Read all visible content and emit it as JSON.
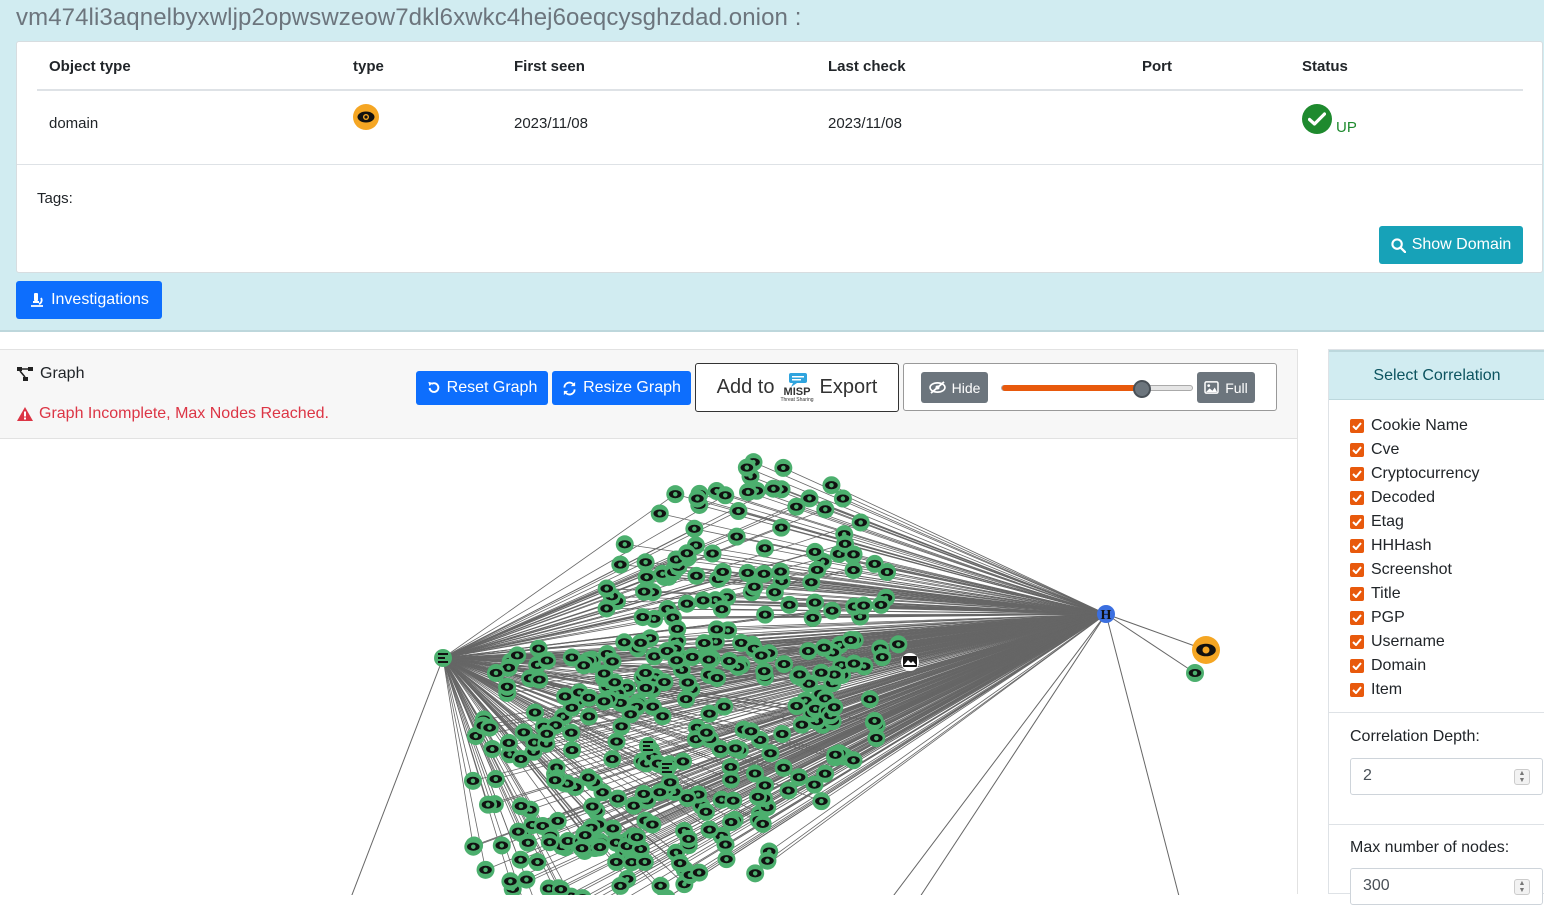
{
  "domain": {
    "title": "vm474li3aqnelbyxwljp2opwswzeow7dkl6xwkc4hej6oeqcysghzdad.onion :",
    "table": {
      "headers": [
        "Object type",
        "type",
        "First seen",
        "Last check",
        "Port",
        "Status"
      ],
      "row": {
        "object_type": "domain",
        "type_icon": "eye-icon",
        "first_seen": "2023/11/08",
        "last_check": "2023/11/08",
        "port": "",
        "status": "UP"
      }
    },
    "tags_label": "Tags:",
    "show_domain_label": "Show Domain"
  },
  "investigations_label": "Investigations",
  "graph": {
    "title": "Graph",
    "warning": "Graph Incomplete, Max Nodes Reached.",
    "reset_label": "Reset Graph",
    "resize_label": "Resize Graph",
    "export_prefix": "Add to",
    "export_logo_text": "MISP",
    "export_logo_sub": "Threat Sharing",
    "export_suffix": "Export",
    "hide_label": "Hide",
    "full_label": "Full",
    "slider_value": 0.73
  },
  "correlation": {
    "header": "Select Correlation",
    "items": [
      {
        "label": "Cookie Name",
        "checked": true
      },
      {
        "label": "Cve",
        "checked": true
      },
      {
        "label": "Cryptocurrency",
        "checked": true
      },
      {
        "label": "Decoded",
        "checked": true
      },
      {
        "label": "Etag",
        "checked": true
      },
      {
        "label": "HHHash",
        "checked": true
      },
      {
        "label": "Screenshot",
        "checked": true
      },
      {
        "label": "Title",
        "checked": true
      },
      {
        "label": "PGP",
        "checked": true
      },
      {
        "label": "Username",
        "checked": true
      },
      {
        "label": "Domain",
        "checked": true
      },
      {
        "label": "Item",
        "checked": true
      }
    ],
    "depth_label": "Correlation Depth:",
    "depth_value": "2",
    "max_nodes_label": "Max number of nodes:",
    "max_nodes_value": "300"
  },
  "colors": {
    "accent_info": "#17a2b8",
    "primary": "#0d6efd",
    "danger": "#dc3545",
    "success": "#1e8a2e",
    "node_green": "#4caf6e",
    "node_orange": "#f5a623",
    "node_blue": "#3b6fe0",
    "edge": "#666666",
    "checkbox": "#e8590c"
  }
}
